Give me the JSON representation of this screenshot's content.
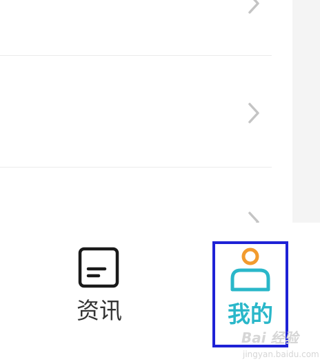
{
  "tabbar": {
    "news_label": "资讯",
    "mine_label": "我的"
  },
  "watermark": {
    "brand": "Bai 经验",
    "sub": "jingyan.baidu.com"
  },
  "colors": {
    "accent": "#2ab7c9",
    "accent_dot": "#f29b2e",
    "highlight_box": "#1e22d6",
    "chevron": "#c4c4c4"
  }
}
